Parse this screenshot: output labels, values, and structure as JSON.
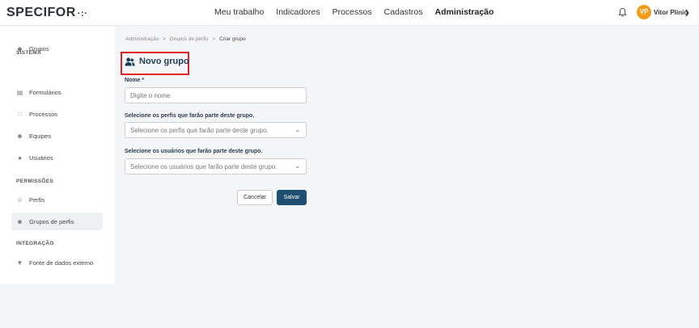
{
  "header": {
    "logo": "SPECIFOR",
    "logo_mark": "·:·",
    "nav": [
      "Meu trabalho",
      "Indicadores",
      "Processos",
      "Cadastros",
      "Administração"
    ],
    "active_nav": "Administração",
    "avatar_initials": "VP",
    "user_name": "Vitor Plinio",
    "avatar_color": "#f29e1b"
  },
  "sidebar": {
    "sections": [
      {
        "title": "SISTEMA",
        "items": [
          {
            "label": "Grupos",
            "icon": "tag-icon"
          },
          {
            "label": "Formulários",
            "icon": "clipboard-icon"
          },
          {
            "label": "Processos",
            "icon": "flow-icon"
          },
          {
            "label": "Equipes",
            "icon": "team-icon"
          },
          {
            "label": "Usuários",
            "icon": "user-icon"
          }
        ]
      },
      {
        "title": "PERMISSÕES",
        "items": [
          {
            "label": "Perfis",
            "icon": "profile-icon"
          },
          {
            "label": "Grupos de perfis",
            "icon": "profile-group-icon",
            "active": true
          }
        ]
      },
      {
        "title": "INTEGRAÇÃO",
        "items": [
          {
            "label": "Fonte de dados externo",
            "icon": "plug-icon"
          }
        ]
      }
    ]
  },
  "breadcrumb": {
    "items": [
      "Administração",
      "Grupos de perfis"
    ],
    "current": "Criar grupo",
    "separator": ">"
  },
  "page": {
    "title": "Novo grupo",
    "accent": "#1d3d56",
    "highlight": "#e0232a"
  },
  "form": {
    "name_label": "Nome *",
    "name_placeholder": "Digite o nome",
    "profiles_label": "Selecione os perfis que farão parte deste grupo.",
    "profiles_placeholder": "Selecione os perfis que farão parte deste grupo.",
    "users_label": "Selecione os usuários que farão parte deste grupo.",
    "users_placeholder": "Selecione os usuários que farão parte deste grupo."
  },
  "actions": {
    "cancel": "Cancelar",
    "save": "Salvar",
    "save_color": "#1f4e6e"
  }
}
